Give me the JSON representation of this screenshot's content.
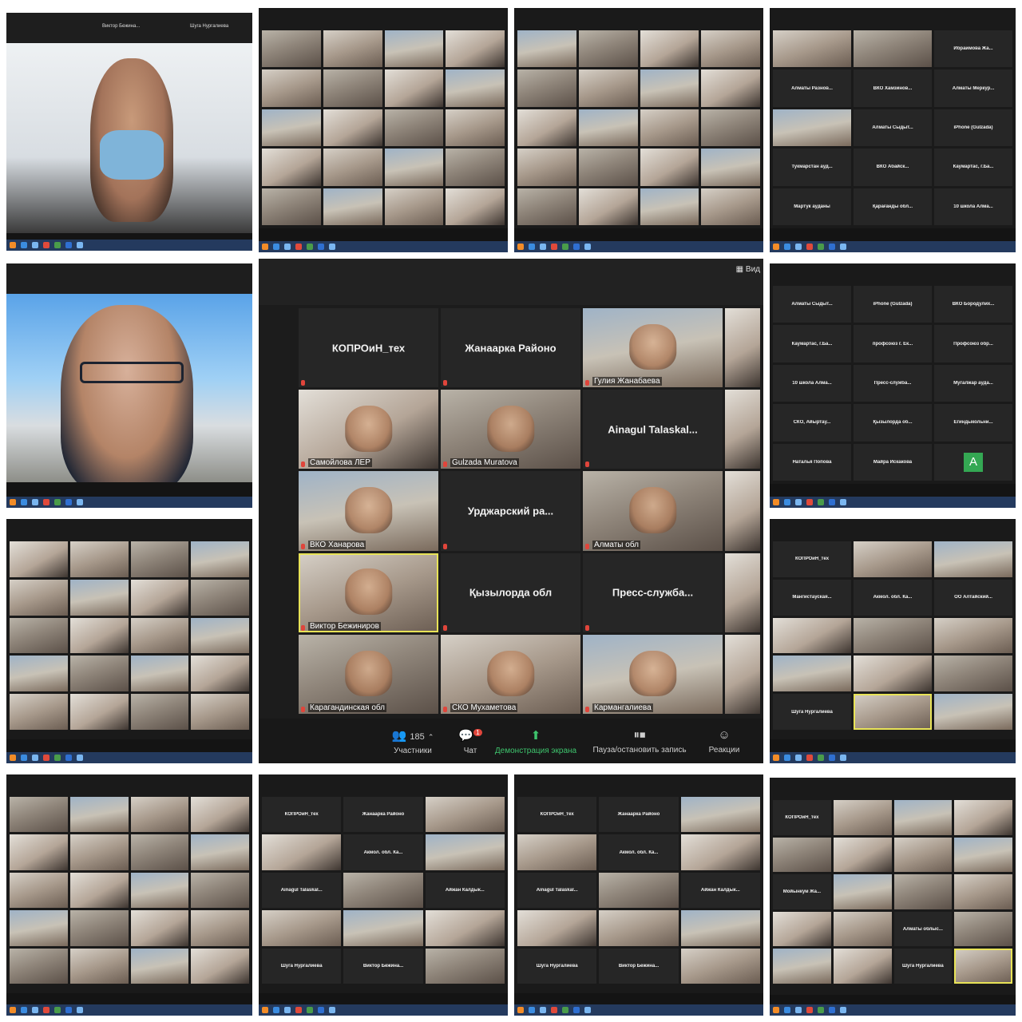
{
  "toolbar": {
    "participants_label": "Участники",
    "participants_count": "185",
    "chat_label": "Чат",
    "chat_badge": "1",
    "share_label": "Демонстрация экрана",
    "record_label": "Пауза/остановить запись",
    "reactions_label": "Реакции"
  },
  "center": {
    "view_button": "Вид",
    "tiles": [
      {
        "name": "КОПРОиН_тех",
        "kind": "name"
      },
      {
        "name": "Жанаарка Районо",
        "kind": "name"
      },
      {
        "name": "Гулия Жанабаева",
        "kind": "cam"
      },
      {
        "name": "Самойлова ЛЕР",
        "kind": "cam"
      },
      {
        "name": "Gulzada Muratova",
        "kind": "cam"
      },
      {
        "name": "Ainagul Talaskal...",
        "kind": "name"
      },
      {
        "name": "ВКО Ханарова",
        "kind": "cam"
      },
      {
        "name": "Урджарский ра...",
        "kind": "name"
      },
      {
        "name": "Алматы обл",
        "kind": "cam"
      },
      {
        "name": "Виктор Бежиниров",
        "kind": "active"
      },
      {
        "name": "Қызылорда обл",
        "kind": "name"
      },
      {
        "name": "Пресс-служба...",
        "kind": "name"
      },
      {
        "name": "Карагандинская обл",
        "kind": "cam"
      },
      {
        "name": "СКО Мухаметова",
        "kind": "cam"
      },
      {
        "name": "Кармангалиева",
        "kind": "cam"
      }
    ]
  },
  "panels": {
    "p1_top": [
      "Виктор Бежина...",
      "Шуга Нургалиева"
    ],
    "p4_names": [
      "Ибраимова Жа...",
      "Алматы Разнов...",
      "ВКО Хамзинов...",
      "Алматы Меркур...",
      "Алматы Сыдыт...",
      "iPhone (Gulzada)",
      "Тукмарстан ауд...",
      "ВКО Абайск...",
      "Каумартас, г.Ба...",
      "Мартук ауданы",
      "Қарағанды обл...",
      "10 школа Алма..."
    ],
    "p8_names": [
      "Алматы Сыдыт...",
      "iPhone (Gulzada)",
      "ВКО Бородулих...",
      "Каумартас, г.Ба...",
      "профсоюз г. Ек...",
      "Профсоюз обр...",
      "10 школа Алма...",
      "Пресс-служба...",
      "Мугалжар ауда...",
      "СКО, Айыртау...",
      "Қызылорда об...",
      "Егиндыкольни...",
      "Наталья Попова",
      "Майра Искакова"
    ],
    "p8_avatar_letter": "A",
    "p10_names": [
      "КОПРОиН_тех",
      "Мангистауская...",
      "Акмол. обл. Ка...",
      "ОО Алтайский...",
      "Шуга Нургалиева"
    ],
    "p14_names": [
      "КОПРОиН_тех",
      "Жанаарка Районо",
      "Акмол. обл. Ка...",
      "Ainagul Talaskal...",
      "Айжан Калдык...",
      "Шуга Нургалиева",
      "Виктор Бежина..."
    ],
    "p15_names": [
      "КОПРОиН_тех",
      "Жанаарка Районо",
      "Акмол. обл. Ка...",
      "Ainagul Talaskal...",
      "Айжан Калдык...",
      "Шуга Нургалиева",
      "Виктор Бежина..."
    ],
    "p16_names": [
      "КОПРОиН_тех",
      "Мойынкум Жа...",
      "Алматы облыс...",
      "Шуга Нургалиева"
    ]
  }
}
